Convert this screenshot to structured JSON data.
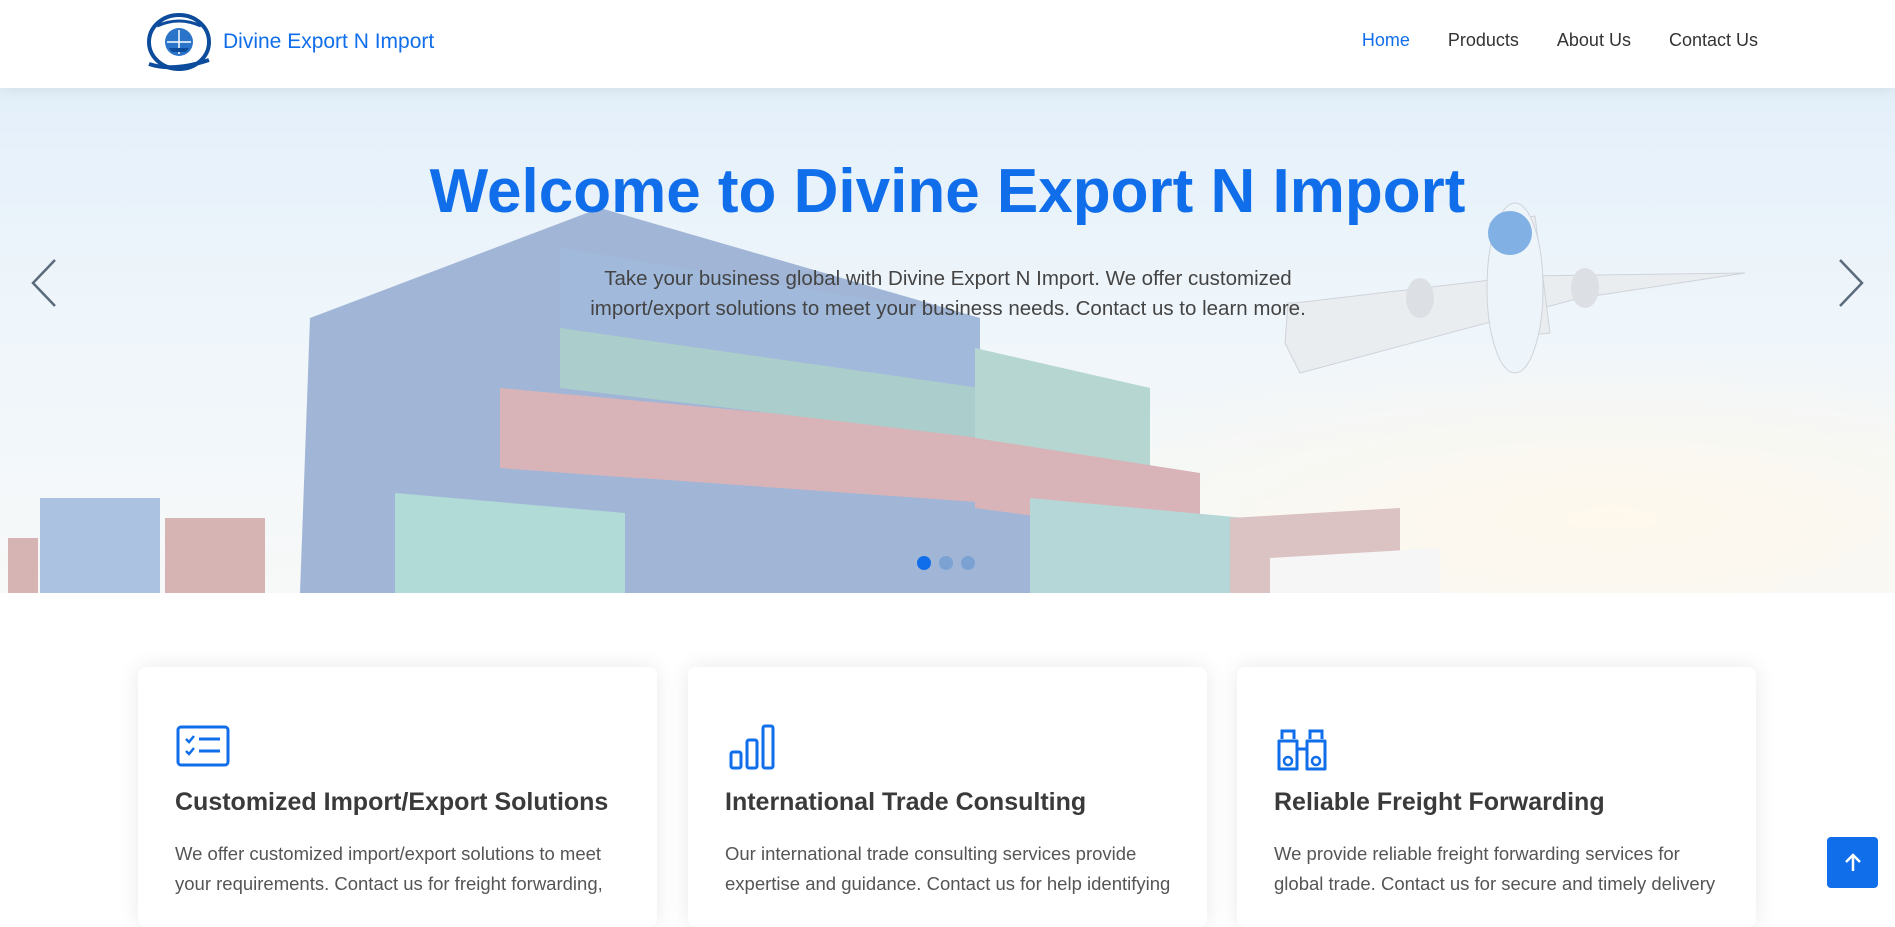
{
  "header": {
    "brand": "Divine Export N Import",
    "nav": [
      {
        "label": "Home",
        "active": true
      },
      {
        "label": "Products",
        "active": false
      },
      {
        "label": "About Us",
        "active": false
      },
      {
        "label": "Contact Us",
        "active": false
      }
    ]
  },
  "hero": {
    "title": "Welcome to Divine Export N Import",
    "text": "Take your business global with Divine Export N Import. We offer customized import/export solutions to meet your business needs. Contact us to learn more.",
    "slides": 3,
    "active_slide": 1,
    "prev_icon": "chevron-left-icon",
    "next_icon": "chevron-right-icon"
  },
  "features": [
    {
      "icon": "checklist-icon",
      "title": "Customized Import/Export Solutions",
      "description": "We offer customized import/export solutions to meet your requirements. Contact us for freight forwarding,"
    },
    {
      "icon": "bar-chart-icon",
      "title": "International Trade Consulting",
      "description": "Our international trade consulting services provide expertise and guidance. Contact us for help identifying"
    },
    {
      "icon": "binoculars-icon",
      "title": "Reliable Freight Forwarding",
      "description": "We provide reliable freight forwarding services for global trade. Contact us for secure and timely delivery"
    }
  ],
  "back_to_top_icon": "arrow-up-icon",
  "colors": {
    "accent": "#106eea",
    "text": "#444444",
    "heading": "#3a3a3a"
  }
}
